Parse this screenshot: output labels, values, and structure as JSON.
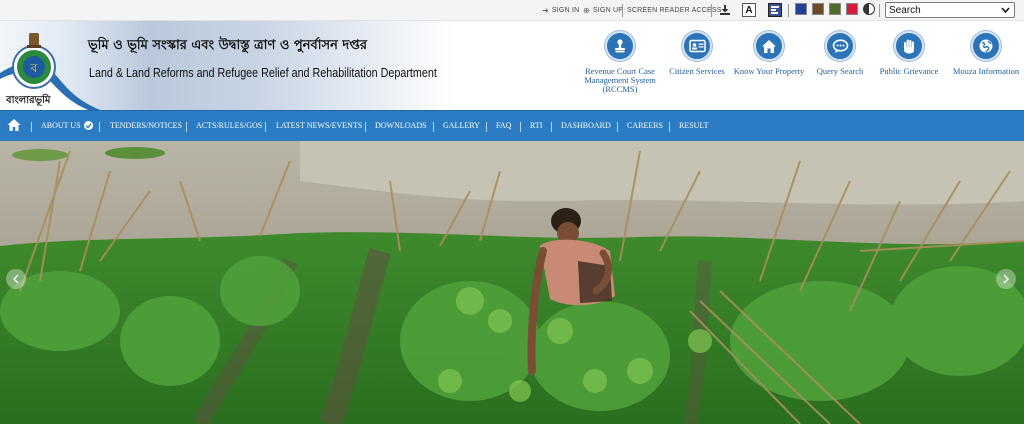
{
  "topbar": {
    "sign_in": "SIGN IN",
    "sign_up": "SIGN UP",
    "screen_reader": "SCREEN READER ACCESS",
    "font_button": "A",
    "theme_colors": [
      "#1f3f99",
      "#6e4a27",
      "#4f6b2a",
      "#d31e3a"
    ],
    "search_selected": "Search"
  },
  "header": {
    "title_bn": "ভূমি ও ভূমি সংস্কার এবং উদ্বাস্তু ত্রাণ ও পুনর্বাসন দপ্তর",
    "title_en": "Land & Land Reforms and Refugee Relief and Rehabilitation Department",
    "brand_bn": "বাংলারভূমি",
    "quick_links": [
      {
        "label": "Revenue Court Case Management System (RCCMS)",
        "icon": "stamp-icon"
      },
      {
        "label": "Citizen Services",
        "icon": "id-card-icon"
      },
      {
        "label": "Know Your Property",
        "icon": "home-icon"
      },
      {
        "label": "Query Search",
        "icon": "chat-icon"
      },
      {
        "label": "Public Grievance",
        "icon": "hand-icon"
      },
      {
        "label": "Mouza Information",
        "icon": "globe-icon"
      }
    ]
  },
  "nav": {
    "items": [
      "ABOUT US",
      "TENDERS/NOTICES",
      "ACTS/RULES/GOS",
      "LATEST NEWS/EVENTS",
      "DOWNLOADS",
      "GALLERY",
      "FAQ",
      "RTI",
      "DASHBOARD",
      "CAREERS",
      "RESULT"
    ]
  },
  "colors": {
    "nav_blue": "#2b7cc2",
    "icon_blue": "#2b74b8",
    "link_blue": "#1f5e9c"
  }
}
